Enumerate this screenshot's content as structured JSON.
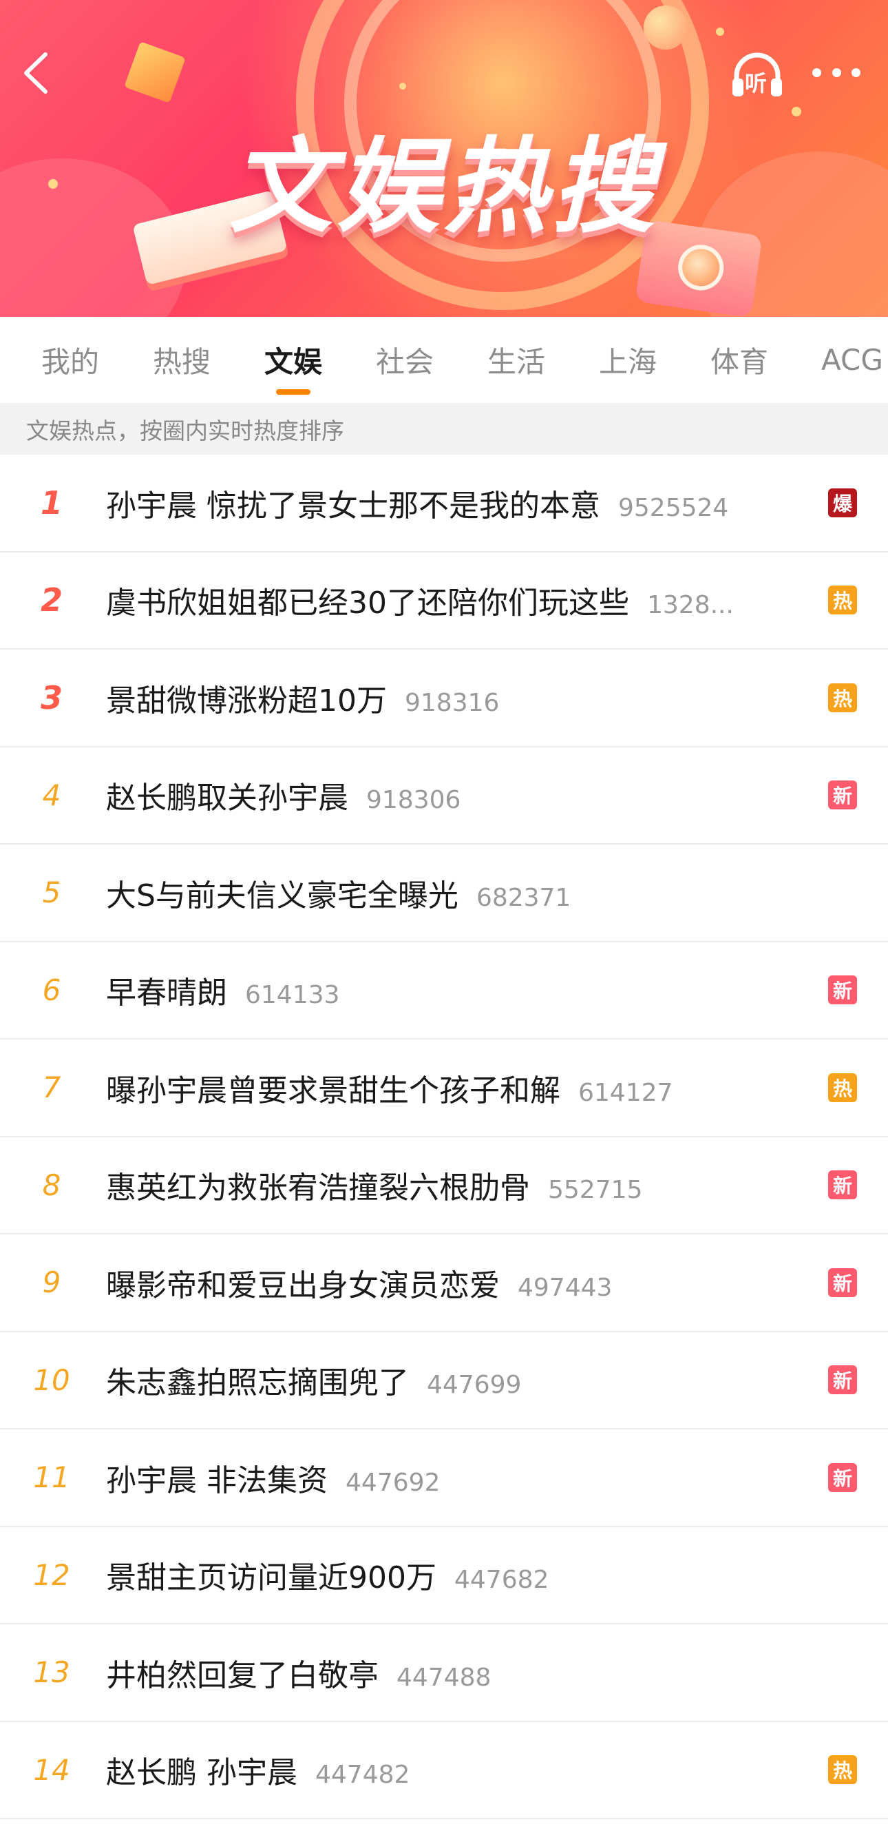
{
  "header": {
    "title": "文娱热搜",
    "back_icon": "chevron-left-icon",
    "listen_label": "听",
    "more_icon": "more-horizontal-icon"
  },
  "tabs": [
    {
      "label": "我的",
      "active": false
    },
    {
      "label": "热搜",
      "active": false
    },
    {
      "label": "文娱",
      "active": true
    },
    {
      "label": "社会",
      "active": false
    },
    {
      "label": "生活",
      "active": false
    },
    {
      "label": "上海",
      "active": false
    },
    {
      "label": "体育",
      "active": false
    },
    {
      "label": "ACG",
      "active": false
    }
  ],
  "subtitle": "文娱热点，按圈内实时热度排序",
  "colors": {
    "accent": "#ff8200",
    "rank_top": "#ff5a4a",
    "rank_other": "#f5a623",
    "badge_bao": "#b8161e",
    "badge_re": "#f7a21b",
    "badge_xin": "#ff5a6e"
  },
  "items": [
    {
      "rank": "1",
      "title": "孙宇晨 惊扰了景女士那不是我的本意",
      "count": "9525524",
      "badge": "爆",
      "badge_type": "bao"
    },
    {
      "rank": "2",
      "title": "虞书欣姐姐都已经30了还陪你们玩这些",
      "count": "1328...",
      "badge": "热",
      "badge_type": "re"
    },
    {
      "rank": "3",
      "title": "景甜微博涨粉超10万",
      "count": "918316",
      "badge": "热",
      "badge_type": "re"
    },
    {
      "rank": "4",
      "title": "赵长鹏取关孙宇晨",
      "count": "918306",
      "badge": "新",
      "badge_type": "xin"
    },
    {
      "rank": "5",
      "title": "大S与前夫信义豪宅全曝光",
      "count": "682371",
      "badge": "",
      "badge_type": ""
    },
    {
      "rank": "6",
      "title": "早春晴朗",
      "count": "614133",
      "badge": "新",
      "badge_type": "xin"
    },
    {
      "rank": "7",
      "title": "曝孙宇晨曾要求景甜生个孩子和解",
      "count": "614127",
      "badge": "热",
      "badge_type": "re"
    },
    {
      "rank": "8",
      "title": "惠英红为救张宥浩撞裂六根肋骨",
      "count": "552715",
      "badge": "新",
      "badge_type": "xin"
    },
    {
      "rank": "9",
      "title": "曝影帝和爱豆出身女演员恋爱",
      "count": "497443",
      "badge": "新",
      "badge_type": "xin"
    },
    {
      "rank": "10",
      "title": "朱志鑫拍照忘摘围兜了",
      "count": "447699",
      "badge": "新",
      "badge_type": "xin"
    },
    {
      "rank": "11",
      "title": "孙宇晨 非法集资",
      "count": "447692",
      "badge": "新",
      "badge_type": "xin"
    },
    {
      "rank": "12",
      "title": "景甜主页访问量近900万",
      "count": "447682",
      "badge": "",
      "badge_type": ""
    },
    {
      "rank": "13",
      "title": "井柏然回复了白敬亭",
      "count": "447488",
      "badge": "",
      "badge_type": ""
    },
    {
      "rank": "14",
      "title": "赵长鹏 孙宇晨",
      "count": "447482",
      "badge": "热",
      "badge_type": "re"
    }
  ]
}
